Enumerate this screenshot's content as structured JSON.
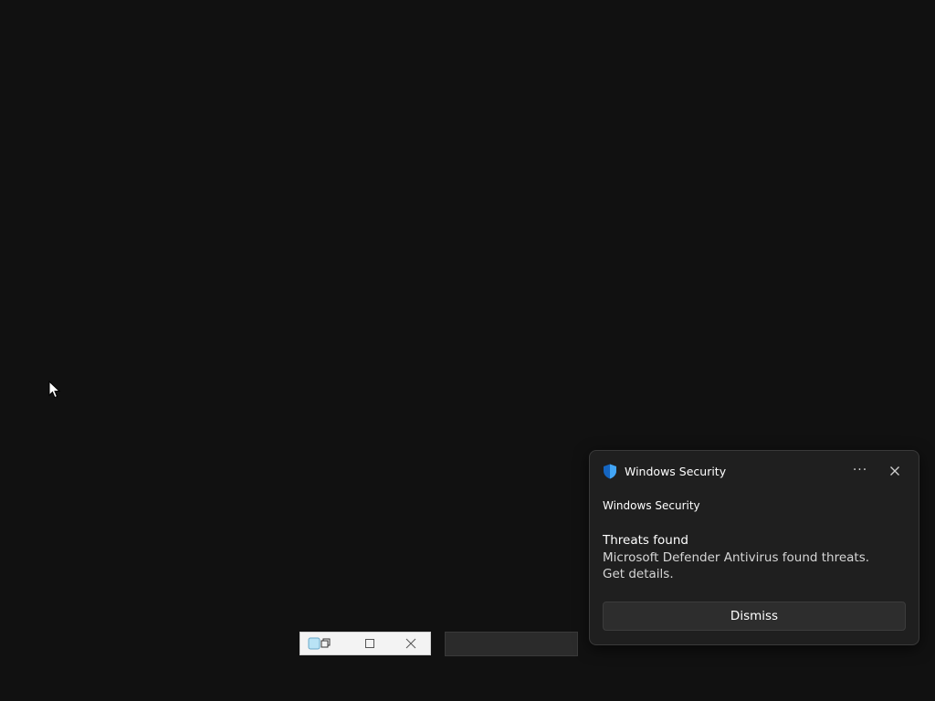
{
  "toast": {
    "app_name": "Windows Security",
    "more_label": "···",
    "source": "Windows Security",
    "title": "Threats found",
    "body": "Microsoft Defender Antivirus found threats. Get details.",
    "dismiss_label": "Dismiss",
    "app_icon": "shield-icon"
  },
  "mini_window": {
    "icons": [
      "app-icon",
      "restore-icon",
      "maximize-icon",
      "close-icon"
    ]
  },
  "colors": {
    "desktop_bg": "#111111",
    "toast_bg": "#1f1f1f",
    "shield_blue": "#1e90ff",
    "dismiss_bg": "#2d2d2d"
  }
}
